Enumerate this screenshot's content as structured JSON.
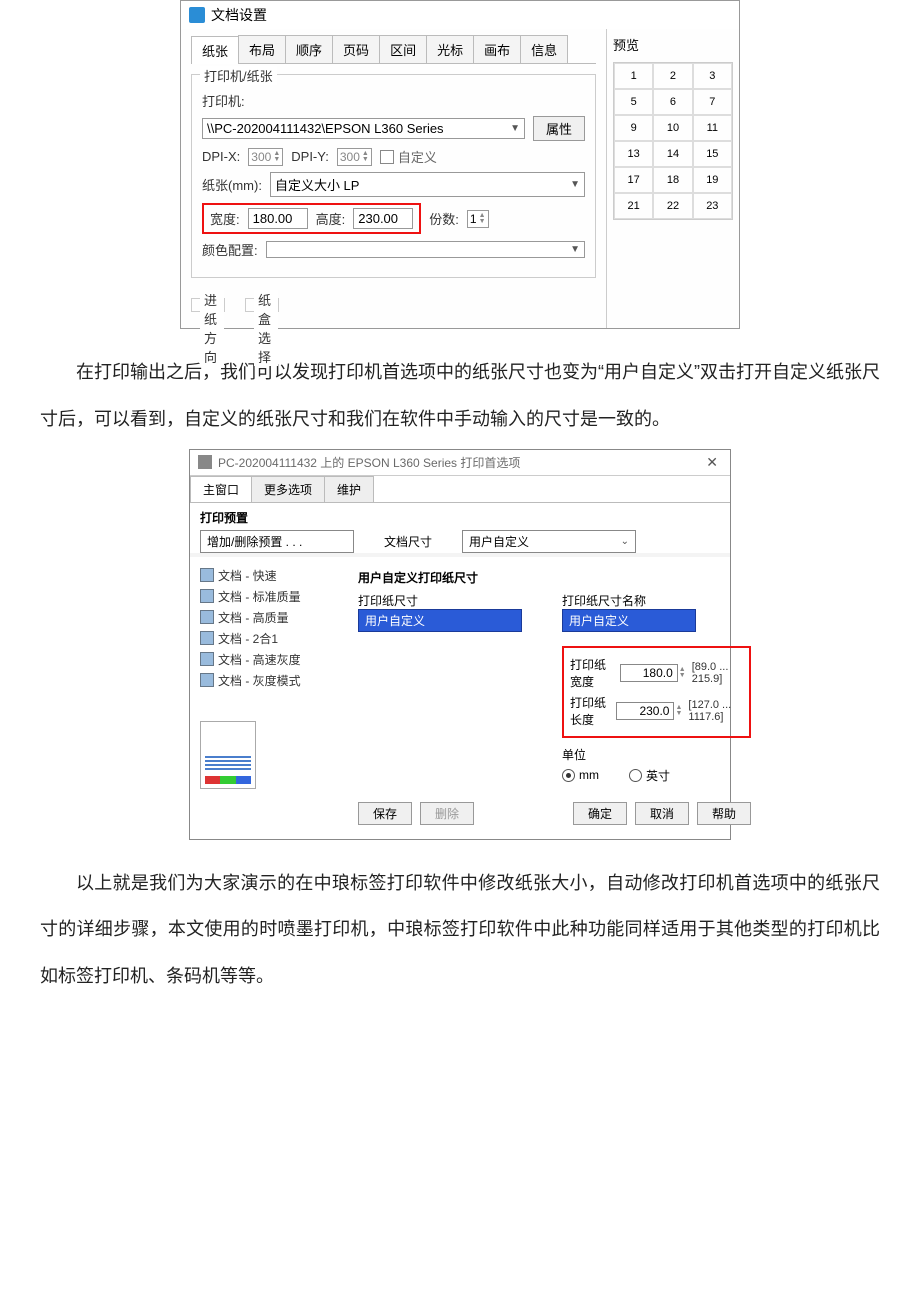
{
  "dialog1": {
    "title": "文档设置",
    "tabs": [
      "纸张",
      "布局",
      "顺序",
      "页码",
      "区间",
      "光标",
      "画布",
      "信息"
    ],
    "group_printer_title": "打印机/纸张",
    "printer_label": "打印机:",
    "printer_value": "\\\\PC-202004111432\\EPSON L360 Series",
    "prop_btn": "属性",
    "dpix_label": "DPI-X:",
    "dpix_value": "300",
    "dpiy_label": "DPI-Y:",
    "dpiy_value": "300",
    "custom_chk": "自定义",
    "paper_label": "纸张(mm):",
    "paper_value": "自定义大小 LP",
    "width_label": "宽度:",
    "width_value": "180.00",
    "height_label": "高度:",
    "height_value": "230.00",
    "copies_label": "份数:",
    "copies_value": "1",
    "color_label": "颜色配置:",
    "feed_group": "进纸方向",
    "tray_group": "纸盒选择",
    "preview_title": "预览",
    "preview_cells": [
      "1",
      "2",
      "3",
      "5",
      "6",
      "7",
      "9",
      "10",
      "11",
      "13",
      "14",
      "15",
      "17",
      "18",
      "19",
      "21",
      "22",
      "23"
    ]
  },
  "para1": "在打印输出之后，我们可以发现打印机首选项中的纸张尺寸也变为“用户自定义”双击打开自定义纸张尺寸后，可以看到，自定义的纸张尺寸和我们在软件中手动输入的尺寸是一致的。",
  "dialog2": {
    "caption": "PC-202004111432 上的 EPSON L360 Series 打印首选项",
    "tabs": [
      "主窗口",
      "更多选项",
      "维护"
    ],
    "presets_title": "打印预置",
    "add_remove": "增加/删除预置 . . .",
    "presets": [
      "文档 - 快速",
      "文档 - 标准质量",
      "文档 - 高质量",
      "文档 - 2合1",
      "文档 - 高速灰度",
      "文档 - 灰度模式"
    ],
    "docsize_label": "文档尺寸",
    "docsize_value": "用户自定义",
    "ud_size_title": "用户自定义打印纸尺寸",
    "paper_size_label": "打印纸尺寸",
    "paper_size_value": "用户自定义",
    "paper_name_label": "打印纸尺寸名称",
    "paper_name_value": "用户自定义",
    "paper_w_label": "打印纸宽度",
    "paper_w_value": "180.0",
    "paper_w_range": "[89.0 ... 215.9]",
    "paper_h_label": "打印纸长度",
    "paper_h_value": "230.0",
    "paper_h_range": "[127.0 ... 1117.6]",
    "unit_label": "单位",
    "unit_mm": "mm",
    "unit_inch": "英寸",
    "save_btn": "保存",
    "delete_btn": "删除",
    "ok_btn": "确定",
    "cancel_btn": "取消",
    "help_btn": "帮助"
  },
  "para2": "以上就是我们为大家演示的在中琅标签打印软件中修改纸张大小，自动修改打印机首选项中的纸张尺寸的详细步骤，本文使用的时喷墨打印机，中琅标签打印软件中此种功能同样适用于其他类型的打印机比如标签打印机、条码机等等。"
}
